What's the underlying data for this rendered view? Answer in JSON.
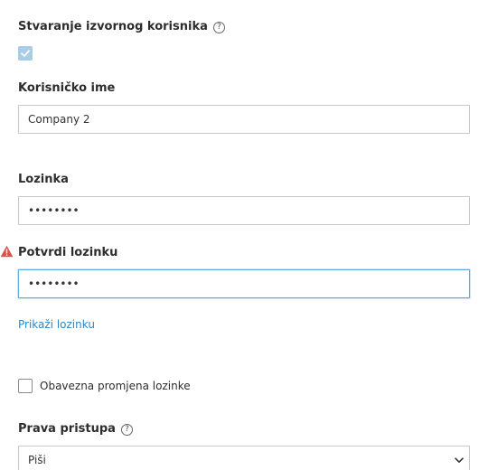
{
  "source_user": {
    "label": "Stvaranje izvornog korisnika",
    "help_glyph": "?",
    "checked": true
  },
  "username": {
    "label": "Korisničko ime",
    "value": "Company 2"
  },
  "password": {
    "label": "Lozinka",
    "value": "••••••••"
  },
  "confirm_password": {
    "label": "Potvrdi lozinku",
    "value": "••••••••",
    "warning_icon": "warning-triangle-icon"
  },
  "show_password_link": "Prikaži lozinku",
  "force_change": {
    "label": "Obavezna promjena lozinke",
    "checked": false
  },
  "access_rights": {
    "label": "Prava pristupa",
    "help_glyph": "?",
    "selected": "Piši"
  },
  "colors": {
    "link": "#2c86c6",
    "focus_border": "#5aaee3",
    "checkbox_checked": "#a9cde7",
    "warning": "#d9534f"
  }
}
